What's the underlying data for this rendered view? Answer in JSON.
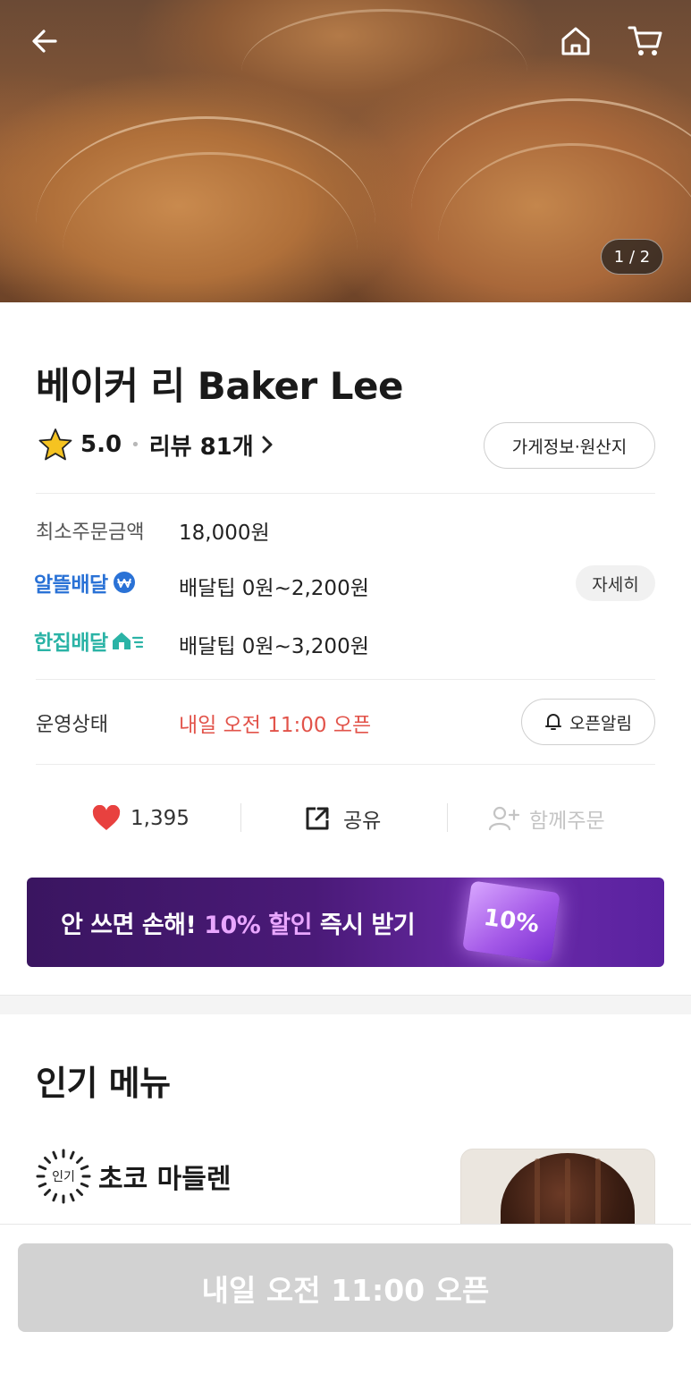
{
  "hero": {
    "image_counter": "1 / 2"
  },
  "store": {
    "name": "베이커 리 Baker Lee",
    "rating": "5.0",
    "review_label": "리뷰 81개",
    "info_button": "가게정보·원산지"
  },
  "order_info": {
    "min_order_label": "최소주문금액",
    "min_order_value": "18,000원",
    "alddeul_label": "알뜰배달",
    "alddeul_tip": "배달팁 0원~2,200원",
    "detail_button": "자세히",
    "hanjip_label": "한집배달",
    "hanjip_tip": "배달팁 0원~3,200원",
    "status_label": "운영상태",
    "status_value": "내일 오전 11:00 오픈",
    "alarm_button": "오픈알림"
  },
  "actions": {
    "like_count": "1,395",
    "share_label": "공유",
    "together_label": "함께주문"
  },
  "banner": {
    "text_prefix": "안 쓰면 손해! ",
    "text_highlight": "10% 할인",
    "text_suffix": " 즉시 받기",
    "coupon_label": "10%"
  },
  "popular": {
    "title": "인기 메뉴",
    "badge": "인기",
    "item_name": "초코 마들렌"
  },
  "cta": {
    "label": "내일 오전 11:00 오픈"
  },
  "colors": {
    "status_red": "#e2534a",
    "alddeul_blue": "#2a72d6",
    "hanjip_teal": "#2bb3a6",
    "like_red": "#e8413f",
    "banner_purple": "#4a1a78",
    "cta_disabled": "#d2d2d2"
  },
  "icons": [
    "back-arrow-icon",
    "home-icon",
    "cart-icon",
    "star-icon",
    "chevron-right-icon",
    "won-coin-icon",
    "house-speed-icon",
    "bell-icon",
    "heart-icon",
    "share-icon",
    "person-add-icon"
  ]
}
